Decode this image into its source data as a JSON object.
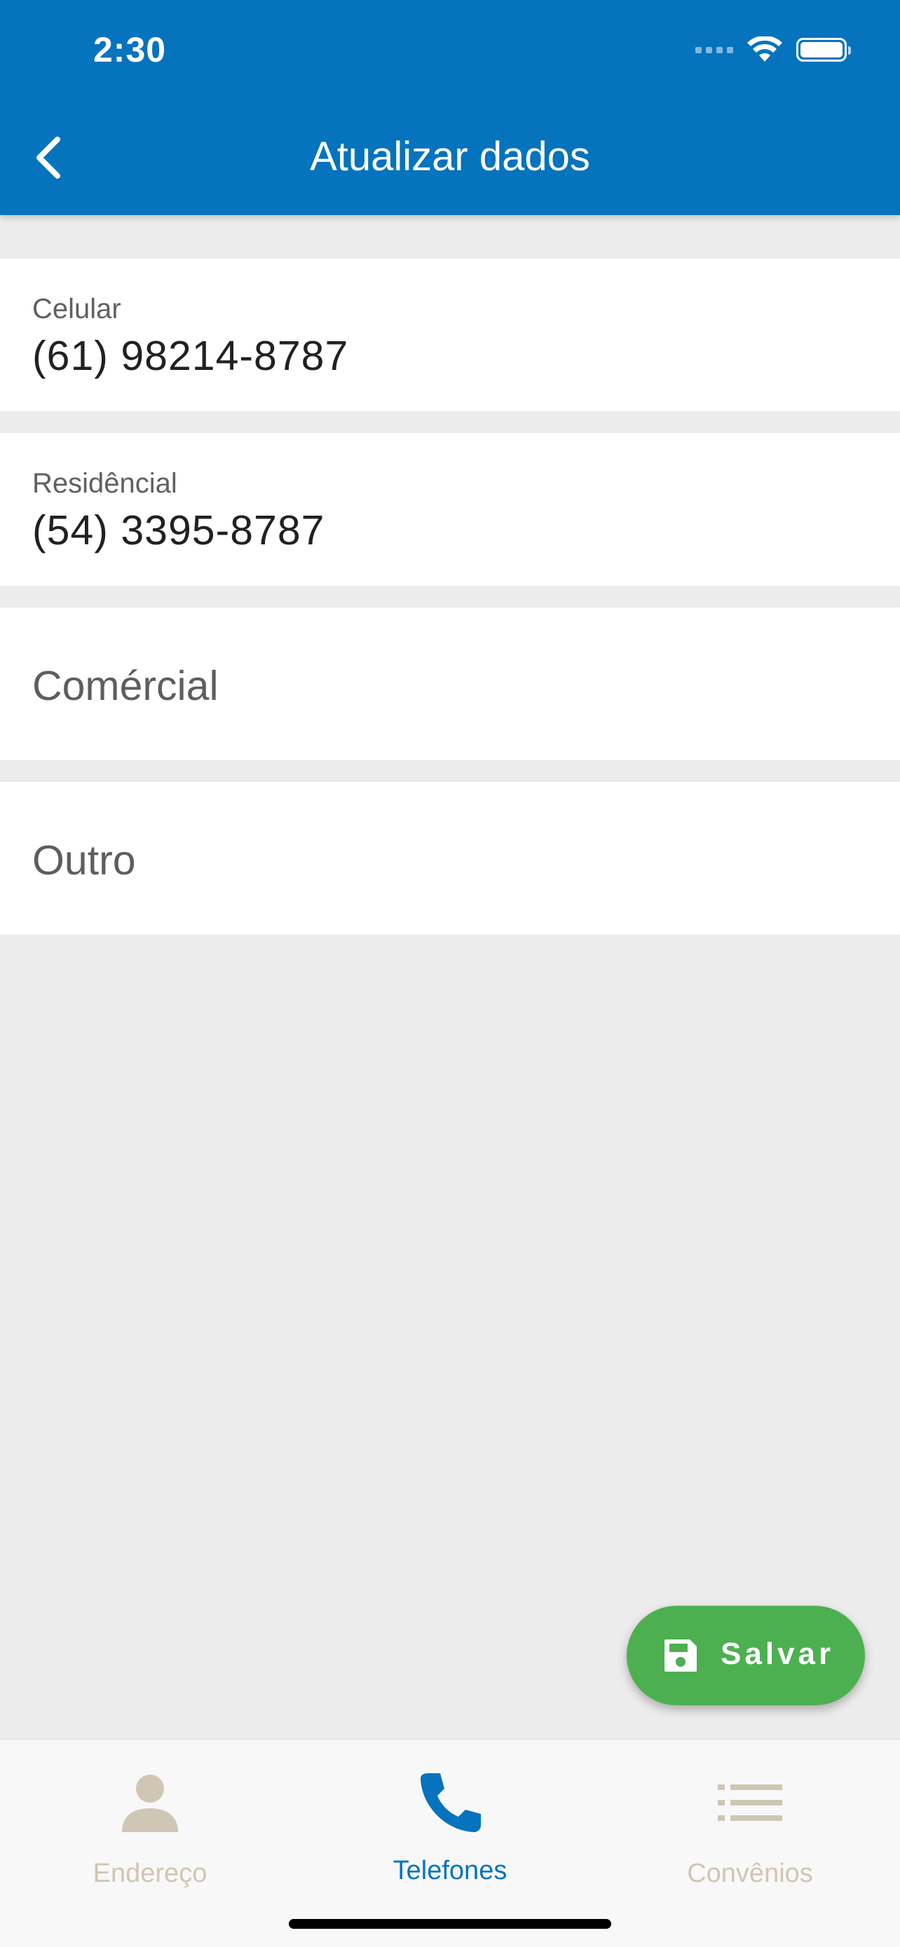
{
  "status_bar": {
    "time": "2:30"
  },
  "header": {
    "title": "Atualizar dados",
    "back_icon": "chevron-left-icon"
  },
  "fields": [
    {
      "label": "Celular",
      "value": "(61) 98214-8787"
    },
    {
      "label": "Residêncial",
      "value": "(54) 3395-8787"
    },
    {
      "placeholder": "Comércial"
    },
    {
      "placeholder": "Outro"
    }
  ],
  "fab": {
    "label": "Salvar",
    "icon": "save-icon",
    "color": "#4cb050"
  },
  "tabs": [
    {
      "label": "Endereço",
      "icon": "person-icon",
      "active": false
    },
    {
      "label": "Telefones",
      "icon": "phone-icon",
      "active": true
    },
    {
      "label": "Convênios",
      "icon": "list-icon",
      "active": false
    }
  ],
  "colors": {
    "primary": "#0573bd",
    "inactive_tab": "#cfc6b3",
    "background": "#ececec"
  }
}
